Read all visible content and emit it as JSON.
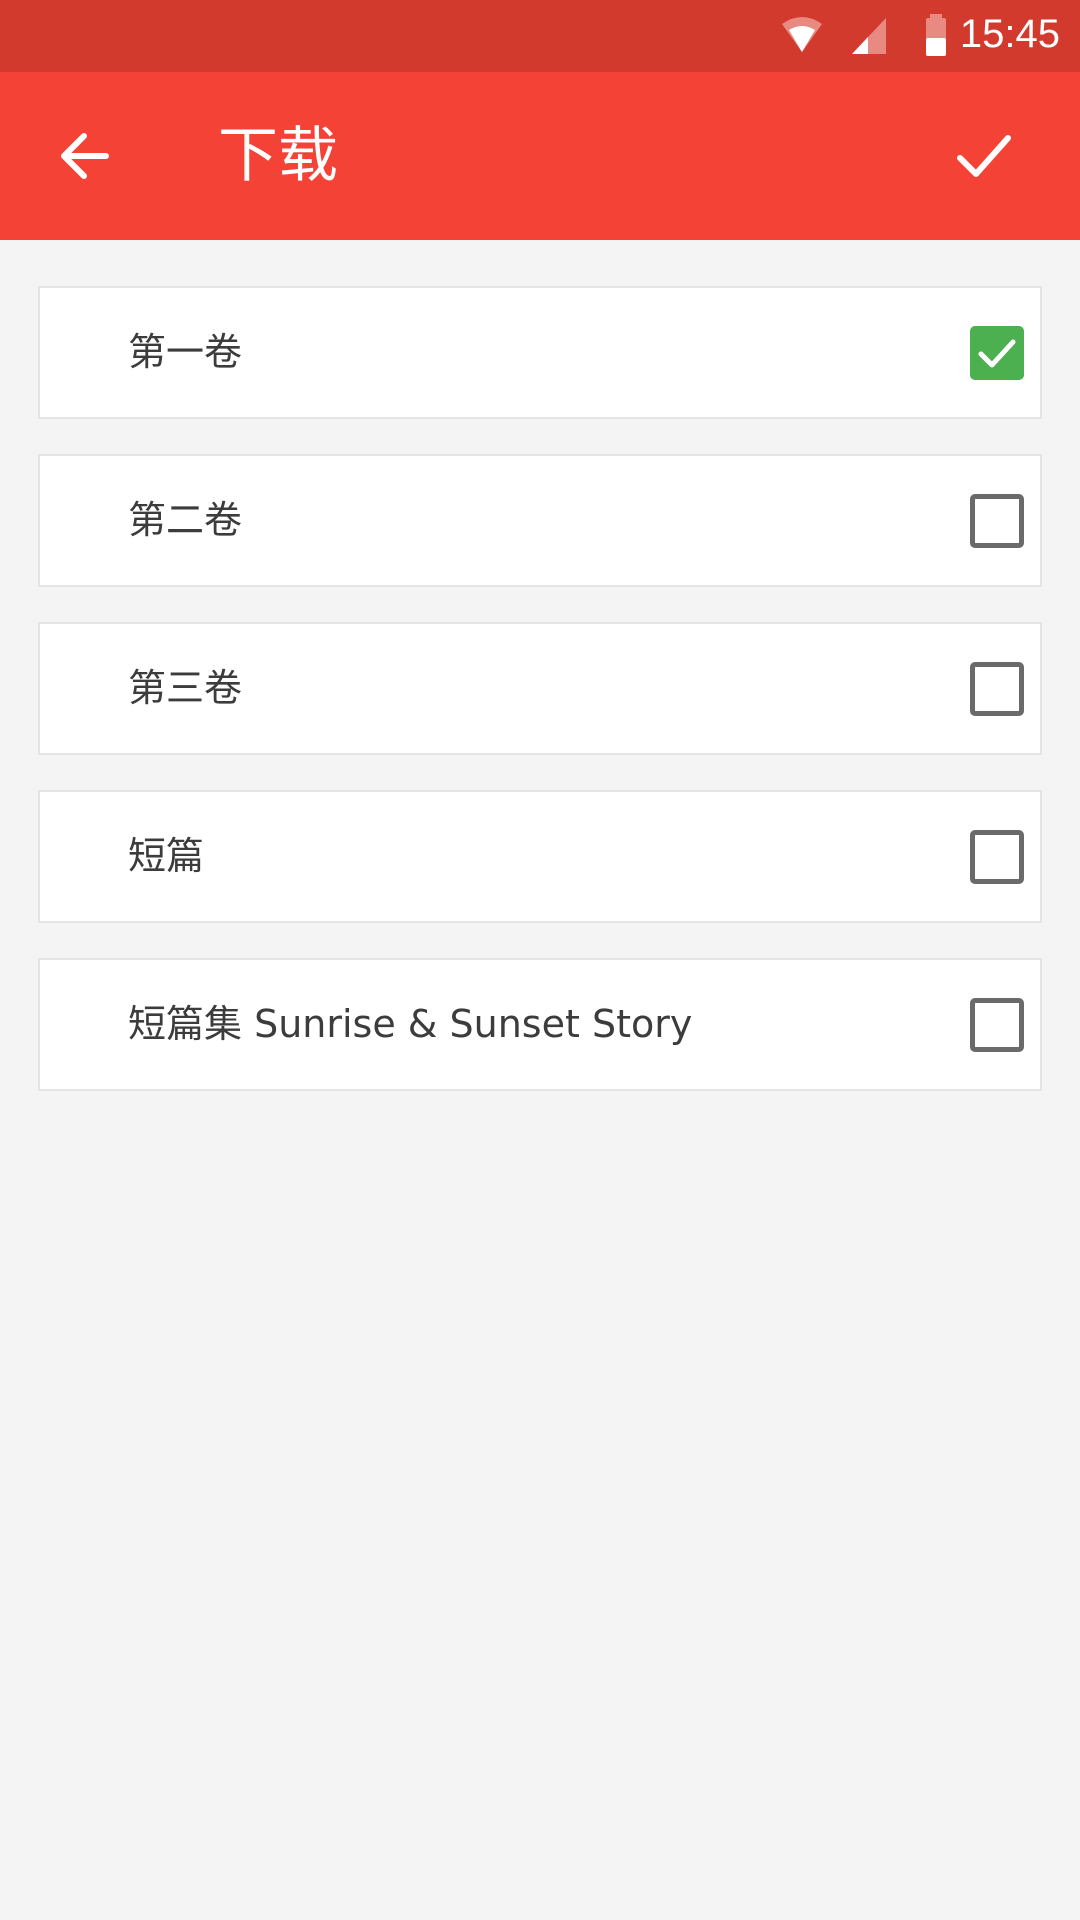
{
  "status_bar": {
    "time": "15:45",
    "icons": [
      "wifi-icon",
      "signal-icon",
      "battery-icon"
    ]
  },
  "app_bar": {
    "title": "下载",
    "back_icon": "arrow-back-icon",
    "confirm_icon": "check-icon",
    "background_color": "#f44336",
    "status_bar_color": "#d23a2e"
  },
  "volumes": [
    {
      "label": "第一卷",
      "checked": true
    },
    {
      "label": "第二卷",
      "checked": false
    },
    {
      "label": "第三卷",
      "checked": false
    },
    {
      "label": "短篇",
      "checked": false
    },
    {
      "label": "短篇集 Sunrise & Sunset Story",
      "checked": false
    }
  ],
  "colors": {
    "checked": "#4caf50",
    "unchecked_border": "#6a6a6a",
    "page_background": "#f4f4f4"
  }
}
